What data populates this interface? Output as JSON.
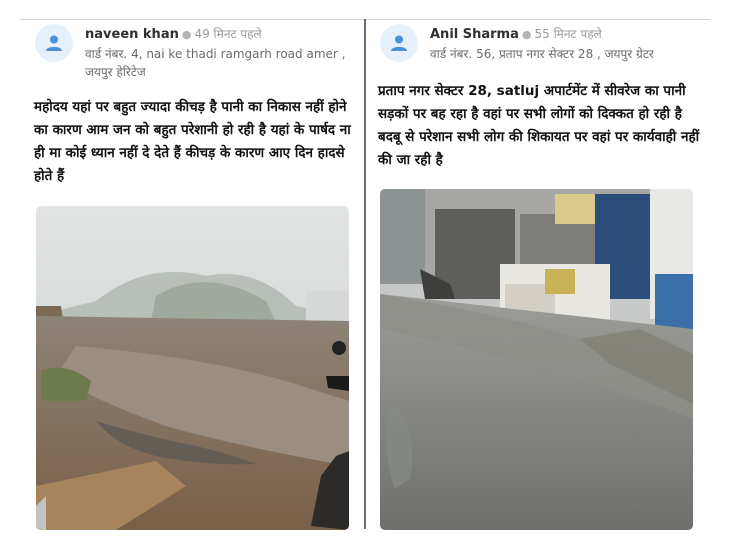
{
  "posts": [
    {
      "author": "naveen khan",
      "time": "49 मिनट पहले",
      "location": "वार्ड नंबर. 4, nai ke thadi ramgarh road amer , जयपुर हेरिटेज",
      "description": "महोदय यहां पर बहुत ज्यादा कीचड़ है पानी का निकास नहीं होने का कारण आम जन को बहुत परेशानी हो रही है यहां के पार्षद ना ही मा कोई ध्यान नहीं दे देते हैं कीचड़ के कारण आए दिन हादसे होते हैं",
      "avatar_icon": "user-icon",
      "photo_alt": "muddy road in fog"
    },
    {
      "author": "Anil Sharma",
      "time": "55 मिनट पहले",
      "location": "वार्ड नंबर. 56, प्रताप नगर सेक्टर 28 , जयपुर ग्रेटर",
      "description": "प्रताप नगर सेक्टर 28, satluj अपार्टमेंट में सीवरेज का पानी सड़कों पर बह रहा है वहां पर सभी लोगों को दिक्कत हो रही है बदबू से परेशान सभी लोग की शिकायत पर वहां पर कार्यवाही नहीं की जा रही है",
      "avatar_icon": "user-icon",
      "photo_alt": "sewage water on street"
    }
  ],
  "colors": {
    "avatar_bg": "#e6f0fb",
    "avatar_icon": "#4a90d9",
    "divider": "#6e6e6e",
    "meta_text": "#9a9a9a"
  }
}
